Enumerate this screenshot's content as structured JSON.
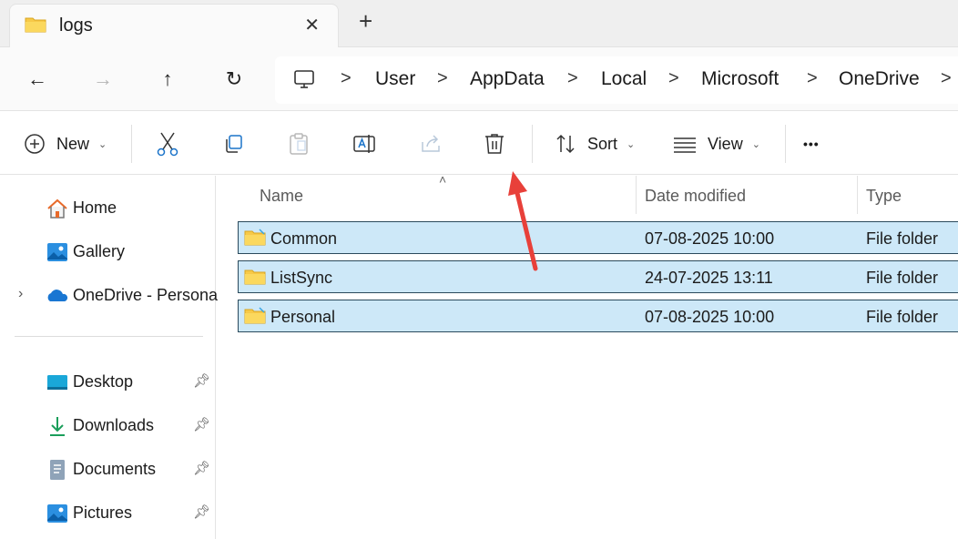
{
  "tab": {
    "title": "logs",
    "close": "✕",
    "new_tab": "+"
  },
  "nav": {
    "back": "←",
    "forward": "→",
    "up": "↑",
    "refresh": "↻"
  },
  "breadcrumb": [
    "User",
    "AppData",
    "Local",
    "Microsoft",
    "OneDrive"
  ],
  "breadcrumb_separator": ">",
  "toolbar": {
    "new_label": "New",
    "sort_label": "Sort",
    "view_label": "View",
    "more": "•••"
  },
  "sidebar": {
    "quick": [
      {
        "label": "Home",
        "icon": "home-icon"
      },
      {
        "label": "Gallery",
        "icon": "gallery-icon"
      },
      {
        "label": "OneDrive - Persona",
        "icon": "onedrive-icon"
      }
    ],
    "pinned": [
      {
        "label": "Desktop",
        "icon": "desktop-icon"
      },
      {
        "label": "Downloads",
        "icon": "downloads-icon"
      },
      {
        "label": "Documents",
        "icon": "documents-icon"
      },
      {
        "label": "Pictures",
        "icon": "pictures-icon"
      }
    ]
  },
  "columns": {
    "name": "Name",
    "date": "Date modified",
    "type": "Type"
  },
  "files": [
    {
      "name": "Common",
      "date": "07-08-2025 10:00",
      "type": "File folder"
    },
    {
      "name": "ListSync",
      "date": "24-07-2025 13:11",
      "type": "File folder"
    },
    {
      "name": "Personal",
      "date": "07-08-2025 10:00",
      "type": "File folder"
    }
  ],
  "colors": {
    "selection": "#cde8f8",
    "arrow": "#e8403a",
    "folder": "#f7c948"
  }
}
